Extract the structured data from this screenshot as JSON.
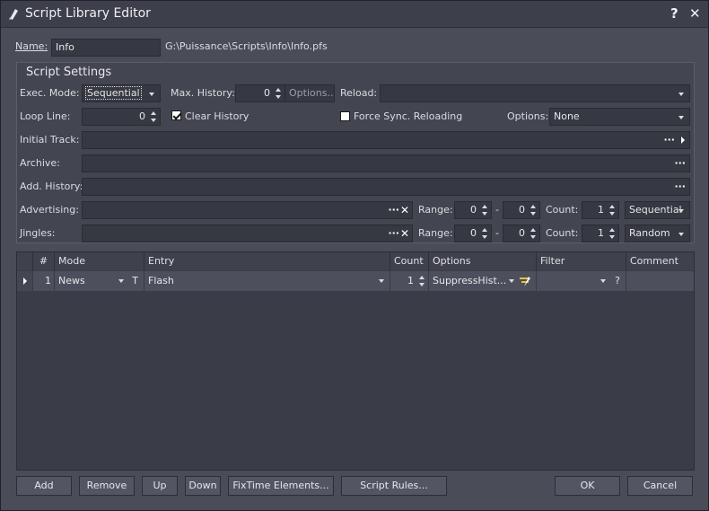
{
  "window": {
    "title": "Script Library Editor",
    "help_glyph": "?",
    "close_glyph": "✕"
  },
  "name": {
    "label": "Name:",
    "value": "Info",
    "path": "G:\\Puissance\\Scripts\\Info\\Info.pfs"
  },
  "settings": {
    "title": "Script Settings",
    "exec_mode_label": "Exec. Mode:",
    "exec_mode_value": "Sequential",
    "max_history_label": "Max. History:",
    "max_history_value": "0",
    "options_link": "Options...",
    "reload_label": "Reload:",
    "reload_value": "",
    "loop_line_label": "Loop Line:",
    "loop_line_value": "0",
    "clear_history_label": "Clear History",
    "clear_history_checked": true,
    "force_sync_label": "Force Sync. Reloading",
    "force_sync_checked": false,
    "options_label": "Options:",
    "options_value": "None",
    "initial_track_label": "Initial Track:",
    "initial_track_value": "",
    "archive_label": "Archive:",
    "archive_value": "",
    "add_history_label": "Add. History:",
    "add_history_value": "",
    "advertising": {
      "label": "Advertising:",
      "value": "",
      "range_label": "Range:",
      "range_from": "0",
      "range_sep": "-",
      "range_to": "0",
      "count_label": "Count:",
      "count": "1",
      "mode": "Sequential"
    },
    "jingles": {
      "label": "Jingles:",
      "value": "",
      "range_label": "Range:",
      "range_from": "0",
      "range_sep": "-",
      "range_to": "0",
      "count_label": "Count:",
      "count": "1",
      "mode": "Random"
    },
    "ellipsis": "···",
    "clear_glyph": "✕"
  },
  "grid": {
    "columns": [
      "#",
      "Mode",
      "Entry",
      "Count",
      "Options",
      "Filter",
      "Comment"
    ],
    "rows": [
      {
        "num": "1",
        "mode": "News",
        "mode_flag": "T",
        "entry": "Flash",
        "count": "1",
        "options": "SuppressHist...",
        "filter": "",
        "filter_flag": "?",
        "comment": ""
      }
    ]
  },
  "buttons": {
    "add": "Add",
    "remove": "Remove",
    "up": "Up",
    "down": "Down",
    "fixtime": "FixTime Elements...",
    "rules": "Script Rules...",
    "ok": "OK",
    "cancel": "Cancel"
  }
}
